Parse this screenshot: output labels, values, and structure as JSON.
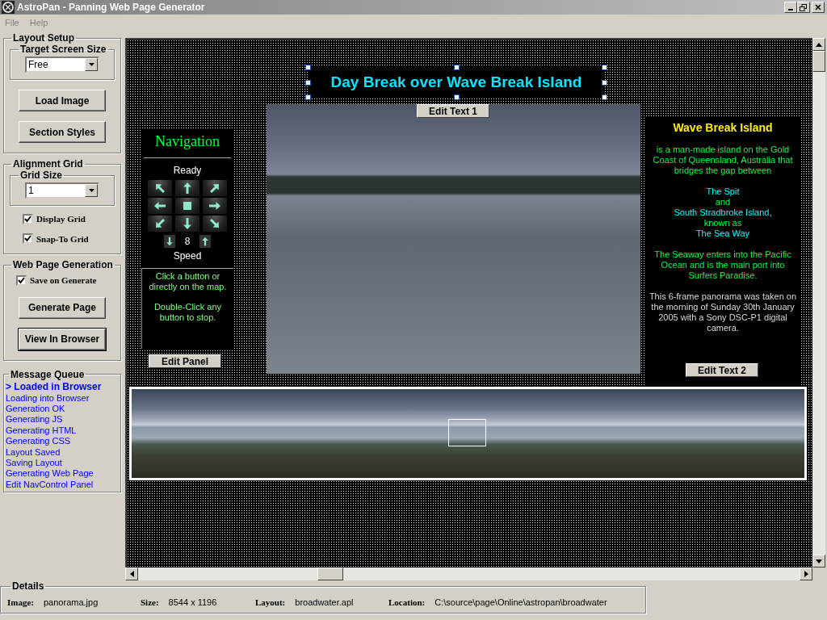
{
  "window": {
    "title": "AstroPan - Panning Web Page Generator"
  },
  "menu": [
    "File",
    "Help"
  ],
  "layout_setup": {
    "title": "Layout Setup",
    "screen_size": {
      "label": "Target Screen Size",
      "value": "Free"
    },
    "buttons": [
      "Load Image",
      "Section Styles"
    ]
  },
  "alignment_grid": {
    "title": "Alignment Grid",
    "grid_size": {
      "label": "Grid Size",
      "value": "1"
    },
    "options": [
      {
        "label": "Display Grid",
        "checked": true
      },
      {
        "label": "Snap-To Grid",
        "checked": true
      }
    ]
  },
  "generation": {
    "title": "Web Page Generation",
    "options": [
      {
        "label": "Save on Generate",
        "checked": true
      }
    ],
    "buttons": [
      {
        "label": "Generate Page",
        "default": false
      },
      {
        "label": "View In Browser",
        "default": true
      }
    ]
  },
  "message_queue": {
    "title": "Message Queue",
    "messages": [
      {
        "text": "> Loaded in Browser",
        "current": true
      },
      {
        "text": "Loading into Browser",
        "current": false
      },
      {
        "text": "Generation OK",
        "current": false
      },
      {
        "text": "Generating JS",
        "current": false
      },
      {
        "text": "Generating HTML",
        "current": false
      },
      {
        "text": "Generating CSS",
        "current": false
      },
      {
        "text": "Layout Saved",
        "current": false
      },
      {
        "text": "Saving Layout",
        "current": false
      },
      {
        "text": "Generating Web Page",
        "current": false
      },
      {
        "text": "Edit NavControl Panel",
        "current": false
      }
    ]
  },
  "canvas": {
    "title_text": {
      "text": "Day Break over Wave Break Island",
      "selected": true
    },
    "edit_text_1": "Edit Text 1",
    "navigation": {
      "title": "Navigation",
      "status": "Ready",
      "speed_value": "8",
      "speed_label": "Speed",
      "help": [
        "Click a button or directly on the map.",
        "Double-Click any button to stop."
      ]
    },
    "edit_panel": "Edit Panel",
    "info": {
      "title": "Wave Break Island",
      "paragraphs": [
        [
          {
            "text": "is a man-made island on the Gold Coast of Queensland, Australia that bridges the gap between",
            "color": "#00ff44"
          }
        ],
        [
          {
            "text": "The Spit",
            "color": "#00ffff"
          },
          {
            "text": "and",
            "color": "#00ff44"
          },
          {
            "text": "South Stradbroke Island,",
            "color": "#00ffff"
          },
          {
            "text": "known as",
            "color": "#00ff44"
          },
          {
            "text": "The Sea Way",
            "color": "#00ffff"
          }
        ],
        [
          {
            "text": "The Seaway enters into the Pacific Ocean and is the main port into Surfers Paradise.",
            "color": "#00ff44"
          }
        ],
        [
          {
            "text": "This 6-frame panorama was taken on the morning of Sunday 30th  January 2005 with a Sony DSC-P1 digital camera.",
            "color": "#d8d8d8"
          }
        ]
      ]
    },
    "edit_text_2": "Edit Text 2"
  },
  "details": {
    "title": "Details",
    "fields": [
      {
        "label": "Image:",
        "value": "panorama.jpg"
      },
      {
        "label": "Size:",
        "value": "8544 x 1196"
      },
      {
        "label": "Layout:",
        "value": "broadwater.apl"
      },
      {
        "label": "Location:",
        "value": "C:\\source\\page\\Online\\astropan\\broadwater"
      }
    ]
  }
}
